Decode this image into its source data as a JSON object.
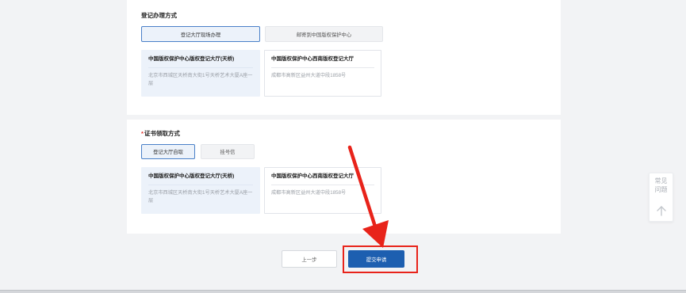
{
  "colors": {
    "page_bg": "#f2f3f5",
    "primary_blue": "#1d5fb0",
    "selected_bg": "#ecf2fa",
    "selected_border": "#4a80c8",
    "required_red": "#e5322d",
    "annotation_red": "#e8231a"
  },
  "registration_method": {
    "title": "登记办理方式",
    "options": [
      {
        "label": "登记大厅现场办理",
        "selected": true
      },
      {
        "label": "邮寄到中国版权保护中心",
        "selected": false
      }
    ],
    "halls": [
      {
        "name": "中国版权保护中心版权登记大厅(天桥)",
        "address": "北京市西城区天桥南大街1号天桥艺术大厦A座一层",
        "selected": true
      },
      {
        "name": "中国版权保护中心西南版权登记大厅",
        "address": "成都市高新区益州大道中段1858号",
        "selected": false
      }
    ]
  },
  "certificate_method": {
    "required_mark": "*",
    "title": "证书领取方式",
    "options": [
      {
        "label": "登记大厅自取",
        "selected": true
      },
      {
        "label": "挂号信",
        "selected": false
      }
    ],
    "halls": [
      {
        "name": "中国版权保护中心版权登记大厅(天桥)",
        "address": "北京市西城区天桥南大街1号天桥艺术大厦A座一层",
        "selected": true
      },
      {
        "name": "中国版权保护中心西南版权登记大厅",
        "address": "成都市高新区益州大道中段1858号",
        "selected": false
      }
    ]
  },
  "actions": {
    "prev_label": "上一步",
    "submit_label": "提交申请"
  },
  "help_widget": {
    "lines": [
      "常见",
      "问题"
    ],
    "icon": "arrow-up-icon"
  }
}
